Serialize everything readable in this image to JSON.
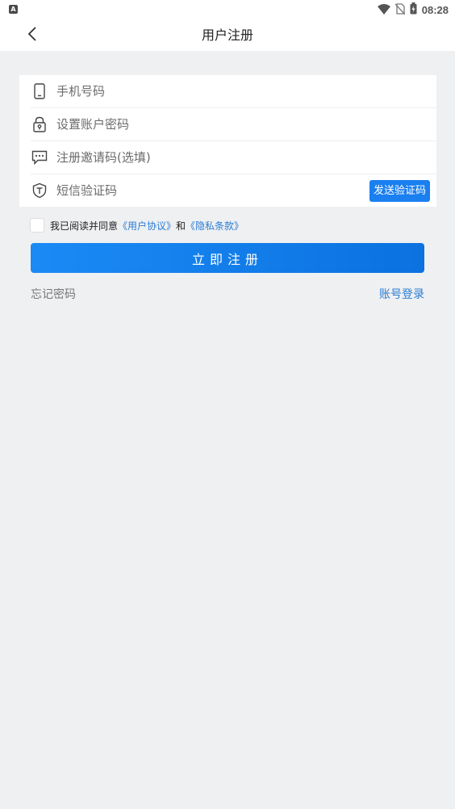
{
  "status_bar": {
    "app_icon": "A",
    "time": "08:28",
    "icons": [
      "wifi-icon",
      "no-sim-icon",
      "battery-charging-icon"
    ]
  },
  "nav": {
    "back_icon": "chevron-left-icon",
    "title": "用户注册"
  },
  "form": {
    "phone": {
      "icon": "phone-icon",
      "placeholder": "手机号码",
      "value": ""
    },
    "password": {
      "icon": "lock-icon",
      "placeholder": "设置账户密码",
      "value": ""
    },
    "invite": {
      "icon": "message-dots-icon",
      "placeholder": "注册邀请码(选填)",
      "value": ""
    },
    "sms": {
      "icon": "shield-icon",
      "placeholder": "短信验证码",
      "value": "",
      "send_label": "发送验证码"
    }
  },
  "agreement": {
    "checked": false,
    "prefix": "我已阅读并同意",
    "user_agreement": "《用户协议》",
    "and": "和",
    "privacy": "《隐私条款》"
  },
  "register_label": "立即注册",
  "forgot_password": "忘记密码",
  "account_login": "账号登录",
  "colors": {
    "primary": "#1a7ff0",
    "link": "#2b7cd3",
    "background": "#eff0f2"
  }
}
